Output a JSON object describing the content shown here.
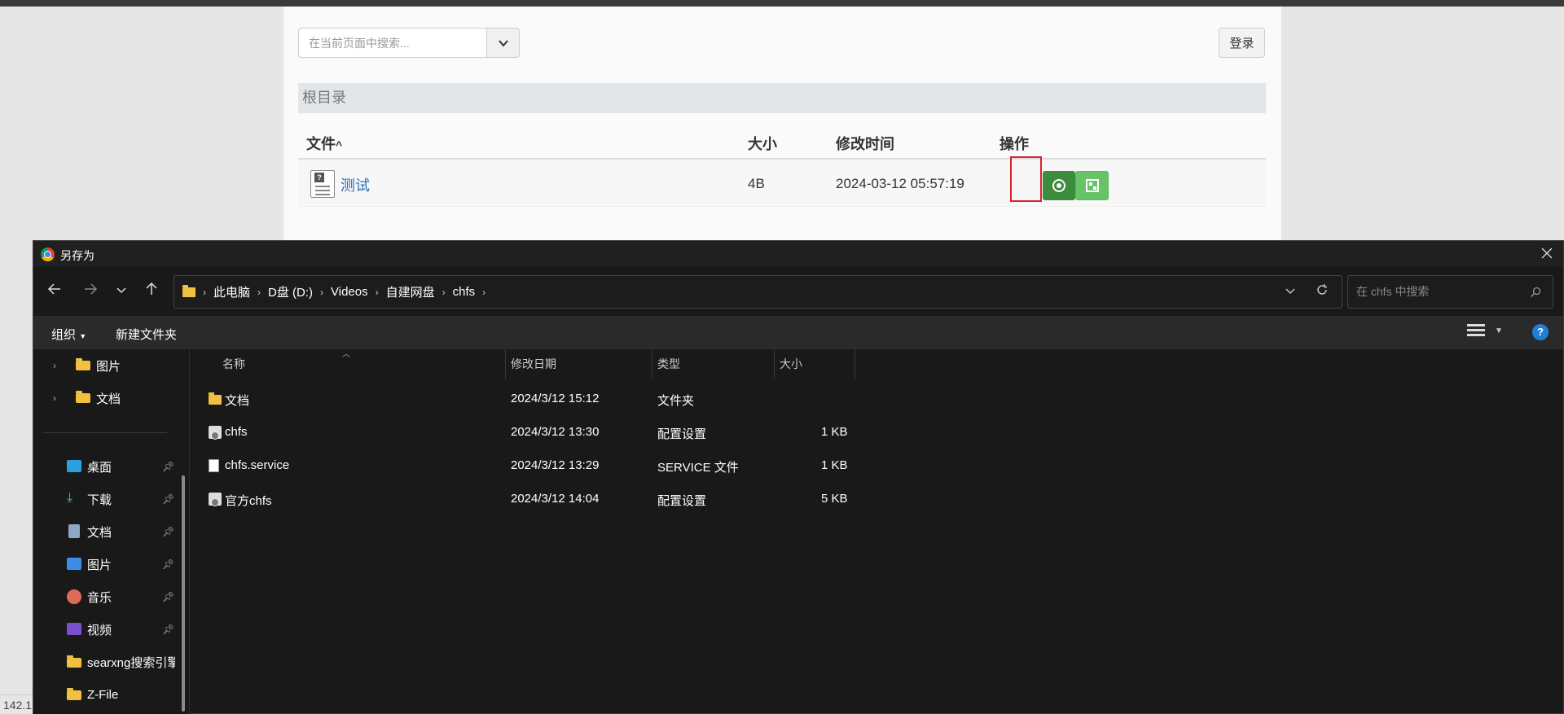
{
  "web": {
    "search_placeholder": "在当前页面中搜索...",
    "login_label": "登录",
    "breadcrumb": "根目录",
    "columns": {
      "file": "文件",
      "size": "大小",
      "modified": "修改时间",
      "action": "操作"
    },
    "rows": [
      {
        "name": "测试",
        "size": "4B",
        "modified": "2024-03-12 05:57:19"
      }
    ],
    "status_ip": "142.1"
  },
  "dialog": {
    "title": "另存为",
    "breadcrumbs": [
      "此电脑",
      "D盘 (D:)",
      "Videos",
      "自建网盘",
      "chfs"
    ],
    "search_placeholder": "在 chfs 中搜索",
    "toolbar": {
      "organize": "组织",
      "new_folder": "新建文件夹"
    },
    "nav_top": [
      {
        "label": "图片"
      },
      {
        "label": "文档"
      }
    ],
    "nav_quick": [
      {
        "label": "桌面",
        "icon": "desktop-icon",
        "pinned": true
      },
      {
        "label": "下载",
        "icon": "download-icon",
        "pinned": true
      },
      {
        "label": "文档",
        "icon": "document-icon",
        "pinned": true
      },
      {
        "label": "图片",
        "icon": "pictures-icon",
        "pinned": true
      },
      {
        "label": "音乐",
        "icon": "music-icon",
        "pinned": true
      },
      {
        "label": "视频",
        "icon": "video-icon",
        "pinned": true
      },
      {
        "label": "searxng搜索引擎",
        "icon": "folder-icon",
        "pinned": false
      },
      {
        "label": "Z-File",
        "icon": "folder-icon",
        "pinned": false
      }
    ],
    "columns": {
      "name": "名称",
      "date": "修改日期",
      "type": "类型",
      "size": "大小"
    },
    "files": [
      {
        "name": "文档",
        "date": "2024/3/12 15:12",
        "type": "文件夹",
        "size": "",
        "icon": "folder"
      },
      {
        "name": "chfs",
        "date": "2024/3/12 13:30",
        "type": "配置设置",
        "size": "1 KB",
        "icon": "config"
      },
      {
        "name": "chfs.service",
        "date": "2024/3/12 13:29",
        "type": "SERVICE 文件",
        "size": "1 KB",
        "icon": "file"
      },
      {
        "name": "官方chfs",
        "date": "2024/3/12 14:04",
        "type": "配置设置",
        "size": "5 KB",
        "icon": "config"
      }
    ]
  }
}
